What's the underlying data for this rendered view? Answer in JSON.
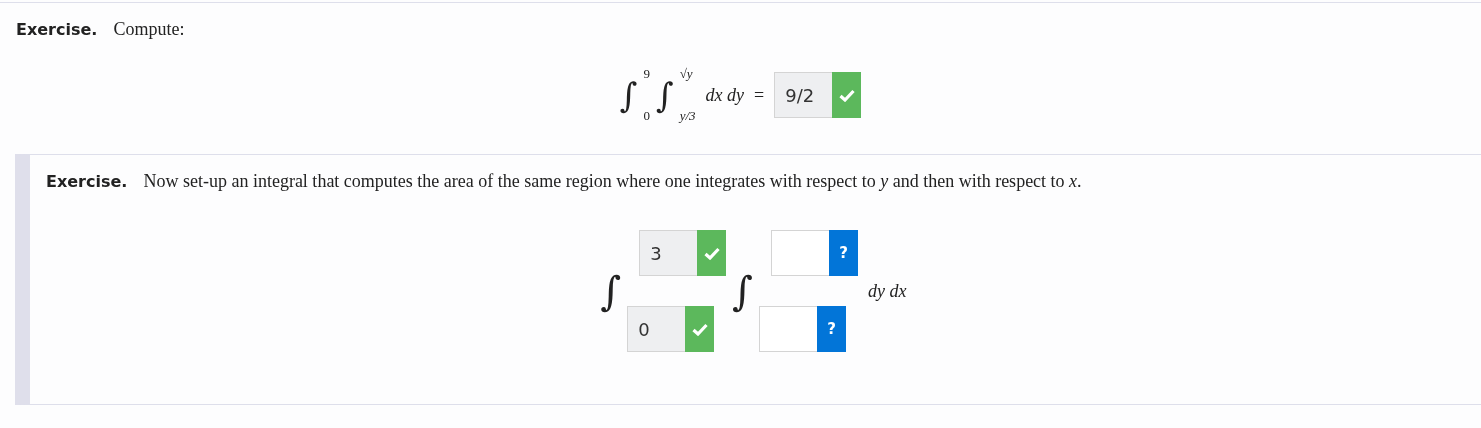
{
  "exercises": [
    {
      "kind": "evaluate",
      "active": false,
      "label": "Exercise.",
      "prompt": "Compute:",
      "integrals": [
        {
          "symbol": "∫",
          "lower": "0",
          "upper": "9"
        },
        {
          "symbol": "∫",
          "lower": "y/3",
          "upper": "√y"
        }
      ],
      "integrand": "dx dy",
      "equals": "=",
      "answer": {
        "value": "9/2",
        "correct": true
      }
    },
    {
      "kind": "setup",
      "active": true,
      "label": "Exercise.",
      "prompt": "Now set-up an integral that computes the area of the same region where one integrates with respect to *y* and then with respect to *x*.",
      "integrals": [
        {
          "symbol": "∫",
          "upper": {
            "value": "3",
            "correct": true
          },
          "lower": {
            "value": "0",
            "correct": true
          }
        },
        {
          "symbol": "∫",
          "upper": {
            "correct": false,
            "button": "?"
          },
          "lower": {
            "correct": false,
            "button": "?"
          }
        }
      ],
      "integrand": "dy dx"
    }
  ]
}
